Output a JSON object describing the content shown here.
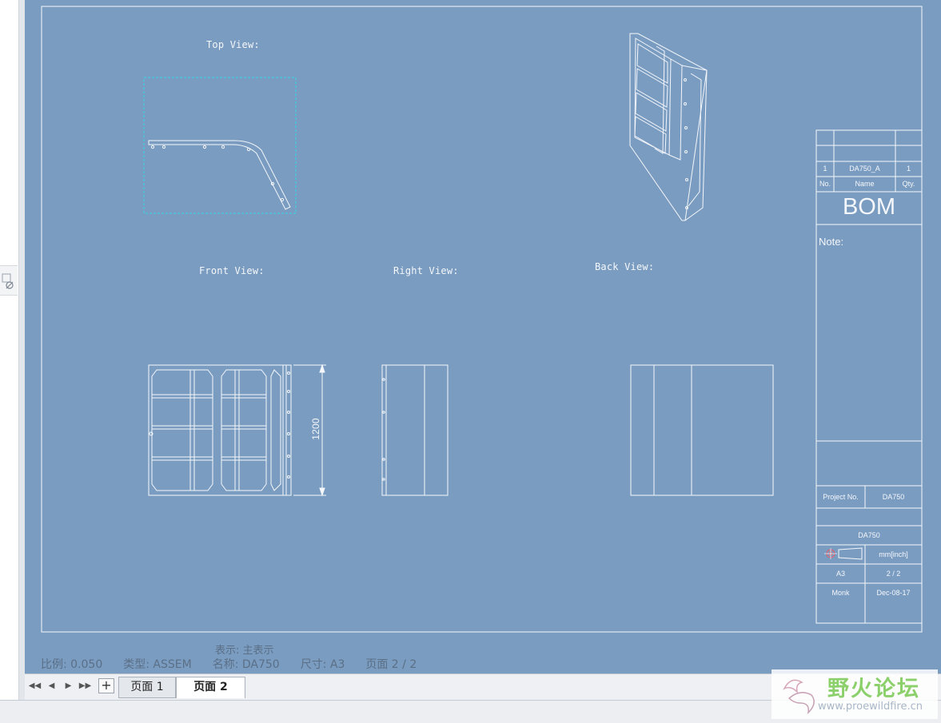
{
  "drawing": {
    "views": {
      "top": "Top View:",
      "front": "Front View:",
      "right": "Right View:",
      "back": "Back View:"
    },
    "dimension": "1200"
  },
  "bom": {
    "row_no": "1",
    "row_name": "DA750_A",
    "row_qty": "1",
    "col_no": "No.",
    "col_name": "Name",
    "col_qty": "Qty.",
    "title": "BOM",
    "note": "Note:",
    "project_label": "Project No.",
    "project_value": "DA750",
    "drawing_name": "DA750",
    "units": "mm[inch]",
    "size": "A3",
    "sheet": "2 / 2",
    "author": "Monk",
    "date": "Dec-08-17"
  },
  "status": {
    "display": "表示: 主表示",
    "scale": "比例: 0.050",
    "type": "类型: ASSEM",
    "name": "名称: DA750",
    "size": "尺寸: A3",
    "page": "页面 2  / 2"
  },
  "tabs": {
    "add": "+",
    "page1": "页面   1",
    "page2": "页面   2"
  },
  "nav": {
    "first": "◀◀",
    "prev": "◀",
    "next": "▶",
    "last": "▶▶"
  },
  "watermark": {
    "title": "野火论坛",
    "url": "www.proewildfire.cn"
  },
  "colors": {
    "sheet_bg": "#7b9cc1",
    "line": "#f4f7fb",
    "selection": "#35d6e6"
  }
}
